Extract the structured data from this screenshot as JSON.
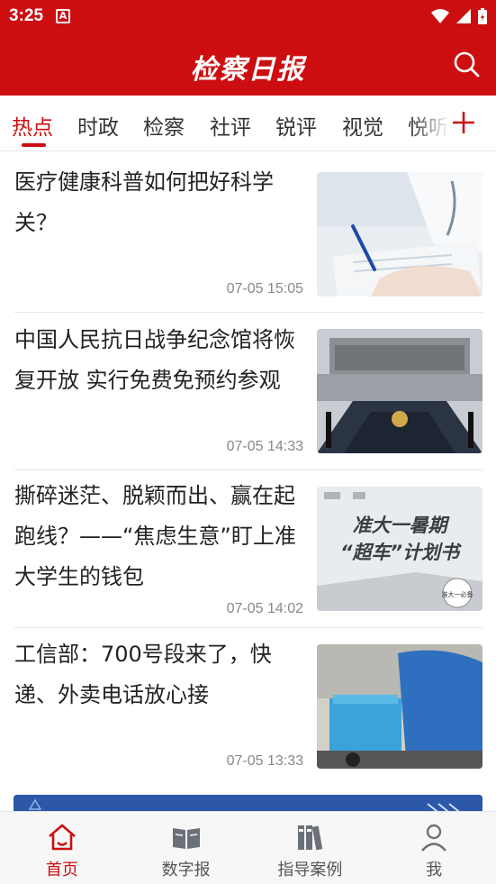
{
  "status_bar": {
    "time": "3:25",
    "notification_icon": "adobe-icon"
  },
  "app_bar": {
    "logo": "检察日报",
    "search_icon": "search-icon"
  },
  "tabs": [
    {
      "label": "热点",
      "active": true
    },
    {
      "label": "时政"
    },
    {
      "label": "检察"
    },
    {
      "label": "社评"
    },
    {
      "label": "锐评"
    },
    {
      "label": "视觉"
    },
    {
      "label": "悦听"
    }
  ],
  "tab_add_icon": "plus-icon",
  "news": [
    {
      "title": "医疗健康科普如何把好科学关？",
      "time": "07-05 15:05",
      "image": "doctor-writing-image"
    },
    {
      "title": "中国人民抗日战争纪念馆将恢复开放 实行免费免预约参观",
      "time": "07-05 14:33",
      "image": "memorial-hall-image"
    },
    {
      "title": "撕碎迷茫、脱颖而出、赢在起跑线？——“焦虑生意”盯上准大学生的钱包",
      "time": "07-05 14:02",
      "image": "summer-plan-poster-image",
      "image_text": {
        "line1": "准大一暑期",
        "line2": "“超车”计划书",
        "badge": "准大一必备"
      }
    },
    {
      "title": "工信部：700号段来了，快递、外卖电话放心接",
      "time": "07-05 13:33",
      "image": "delivery-rider-image"
    }
  ],
  "bottom_nav": [
    {
      "label": "首页",
      "icon": "home-icon",
      "active": true
    },
    {
      "label": "数字报",
      "icon": "book-icon"
    },
    {
      "label": "指导案例",
      "icon": "binders-icon"
    },
    {
      "label": "我",
      "icon": "user-icon"
    }
  ],
  "colors": {
    "brand_red": "#cc0e10",
    "text": "#222222",
    "meta": "#888888",
    "banner_blue": "#2d57a8"
  }
}
